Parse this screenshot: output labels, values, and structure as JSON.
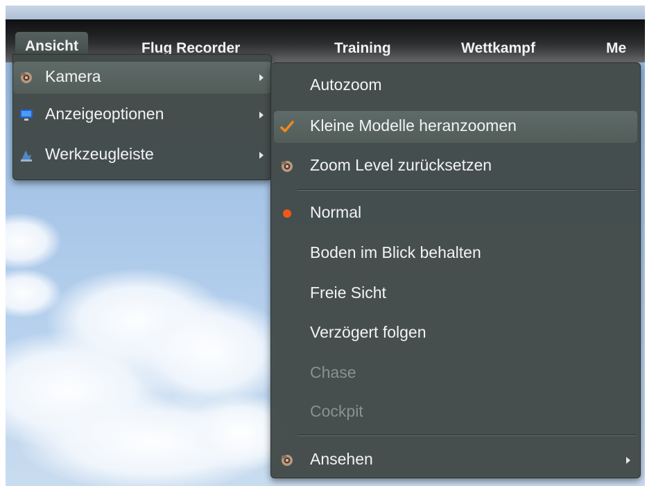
{
  "menubar": {
    "items": [
      {
        "label": "Ansicht"
      },
      {
        "label": "Flug Recorder"
      },
      {
        "label": "Training"
      },
      {
        "label": "Wettkampf"
      },
      {
        "label": "Me"
      }
    ]
  },
  "view_menu": {
    "items": [
      {
        "label": "Kamera",
        "icon": "camera-icon",
        "has_submenu": true,
        "highlighted": true
      },
      {
        "label": "Anzeigeoptionen",
        "icon": "monitor-icon",
        "has_submenu": true
      },
      {
        "label": "Werkzeugleiste",
        "icon": "toolbar-icon",
        "has_submenu": true
      }
    ]
  },
  "camera_submenu": {
    "items": [
      {
        "label": "Autozoom",
        "state": "none"
      },
      {
        "label": "Kleine Modelle heranzoomen",
        "state": "checked",
        "highlighted": true
      },
      {
        "label": "Zoom Level zurücksetzen",
        "icon": "camera-icon"
      },
      {
        "label": "Normal",
        "state": "selected"
      },
      {
        "label": "Boden im Blick behalten",
        "state": "none"
      },
      {
        "label": "Freie Sicht",
        "state": "none"
      },
      {
        "label": "Verzögert folgen",
        "state": "none"
      },
      {
        "label": "Chase",
        "state": "disabled"
      },
      {
        "label": "Cockpit",
        "state": "disabled"
      },
      {
        "label": "Ansehen",
        "icon": "camera-icon",
        "has_submenu": true
      }
    ]
  },
  "colors": {
    "menu_bg": "#424a48",
    "check": "#f08a1a",
    "radio_dot": "#f05a14",
    "disabled_text": "#8a928f"
  }
}
